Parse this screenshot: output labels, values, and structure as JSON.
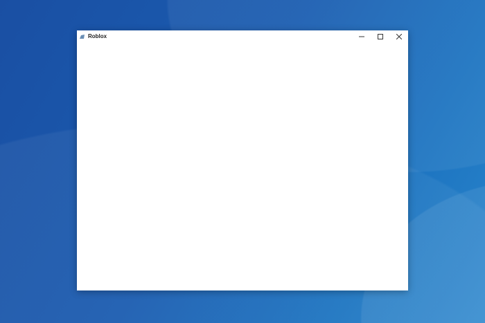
{
  "window": {
    "title": "Roblox",
    "icon": "roblox-icon",
    "controls": [
      "minimize-icon",
      "maximize-icon",
      "close-icon"
    ]
  }
}
